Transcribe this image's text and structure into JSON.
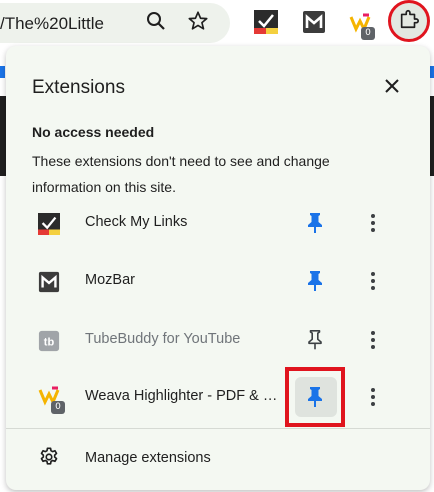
{
  "toolbar": {
    "url_text": "/The%20Little",
    "search_icon": "magnifier-icon",
    "bookmark_icon": "star-icon",
    "extension_badge_count": "0",
    "extensions_button_icon": "puzzle-icon"
  },
  "panel": {
    "title": "Extensions",
    "close_icon": "close-icon",
    "section_title": "No access needed",
    "section_description": "These extensions don't need to see and change information on this site.",
    "extensions": [
      {
        "name": "Check My Links",
        "pinned": true,
        "icon": "check-my-links-icon"
      },
      {
        "name": "MozBar",
        "pinned": true,
        "icon": "mozbar-icon"
      },
      {
        "name": "TubeBuddy for YouTube",
        "pinned": false,
        "icon": "tubebuddy-icon"
      },
      {
        "name": "Weava Highlighter - PDF & Web",
        "pinned": true,
        "icon": "weava-icon",
        "badge": "0"
      }
    ],
    "manage_label": "Manage extensions"
  },
  "colors": {
    "pin_active": "#1a73e8",
    "pin_inactive": "#3c4043",
    "highlight": "#e0141e",
    "panel_bg": "#f4f8f2"
  }
}
